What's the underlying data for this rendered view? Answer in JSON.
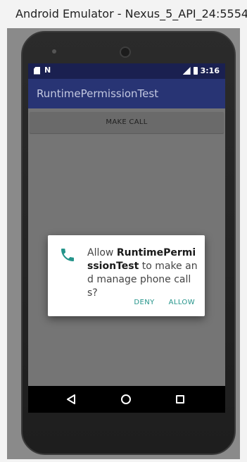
{
  "window": {
    "title": "Android Emulator - Nexus_5_API_24:5554"
  },
  "status_bar": {
    "time": "3:16",
    "left_icons": [
      "sd-card-icon",
      "notification-n-icon"
    ],
    "right_icons": [
      "signal-icon",
      "battery-icon"
    ]
  },
  "app_bar": {
    "title": "RuntimePermissionTest"
  },
  "main": {
    "make_call_label": "MAKE CALL"
  },
  "dialog": {
    "icon": "phone-icon",
    "message_prefix": "Allow ",
    "app_name": "RuntimePermissionTest",
    "message_suffix": " to make and manage phone calls?",
    "deny_label": "DENY",
    "allow_label": "ALLOW"
  },
  "nav_bar": {
    "icons": [
      "back-icon",
      "home-icon",
      "recents-icon"
    ]
  },
  "colors": {
    "status_bar": "#1a2050",
    "app_bar": "#283474",
    "accent": "#24948a",
    "screen_bg": "#757575"
  }
}
